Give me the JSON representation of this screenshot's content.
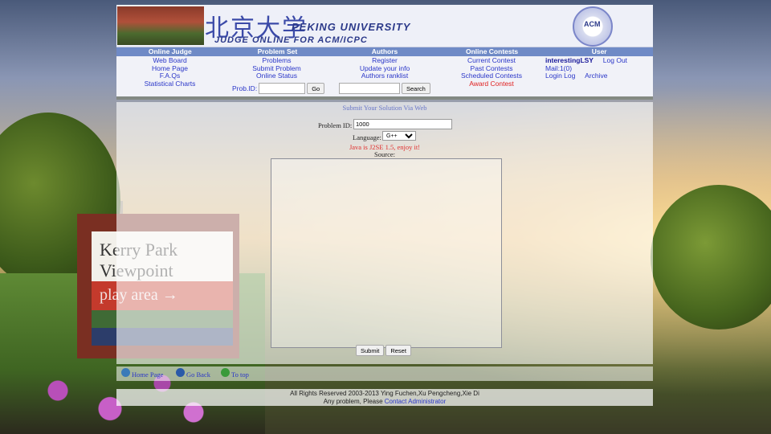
{
  "banner": {
    "chinese_title": "北京大学",
    "university": "PEKING UNIVERSITY",
    "subtitle": "JUDGE ONLINE FOR ACM/ICPC",
    "logo_text": "ACM"
  },
  "menu": {
    "headers": [
      "Online Judge",
      "Problem Set",
      "Authors",
      "Online Contests",
      "User"
    ],
    "online_judge": [
      "Web Board",
      "Home Page",
      "F.A.Qs",
      "Statistical Charts"
    ],
    "problem_set": [
      "Problems",
      "Submit Problem",
      "Online Status"
    ],
    "authors": [
      "Register",
      "Update your info",
      "Authors ranklist"
    ],
    "contests": [
      "Current Contest",
      "Past Contests",
      "Scheduled Contests",
      "Award Contest"
    ],
    "user": {
      "username": "interestingLSY",
      "logout": "Log Out",
      "mail": "Mail:1(0)",
      "login_log": "Login Log",
      "archive": "Archive"
    },
    "prob_id_label": "Prob.ID:",
    "go_label": "Go",
    "search_label": "Search"
  },
  "form": {
    "title": "Submit Your Solution Via Web",
    "problem_id_label": "Problem ID:",
    "problem_id_value": "1000",
    "language_label": "Language:",
    "language_value": "G++",
    "java_note": "Java is J2SE 1.5, enjoy it!",
    "source_label": "Source:",
    "submit_label": "Submit",
    "reset_label": "Reset"
  },
  "nav": {
    "home": "Home Page",
    "back": "Go Back",
    "top": "To top"
  },
  "footer": {
    "rights": "All Rights Reserved 2003-2013 Ying Fuchen,Xu Pengcheng,Xie Di",
    "problem_text": "Any problem, Please",
    "contact": "Contact Administrator"
  },
  "colors": {
    "menu_header_bg": "#6f8ac6",
    "link": "#2a36c8",
    "alert_red": "#e02020"
  }
}
